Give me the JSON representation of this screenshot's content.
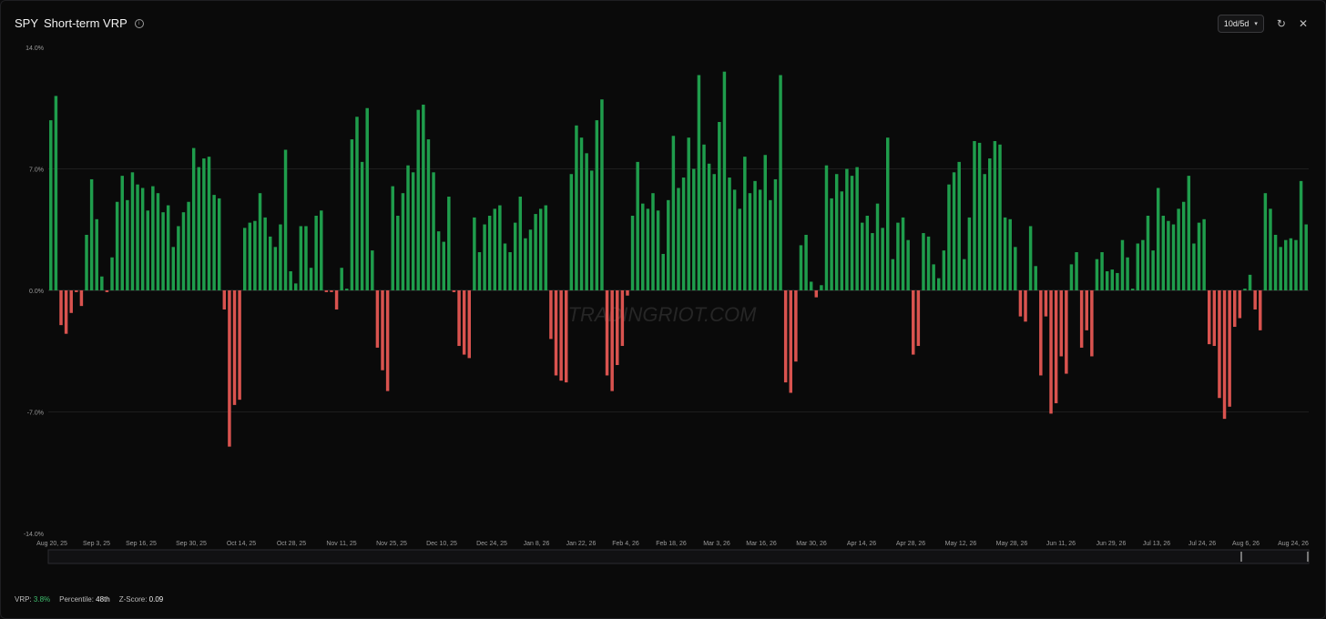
{
  "header": {
    "ticker": "SPY",
    "title": "Short-term VRP",
    "info_icon": "info-icon"
  },
  "controls": {
    "period": "10d/5d",
    "refresh_icon": "refresh-icon",
    "close_icon": "close-icon"
  },
  "watermark": "TRADINGRIOT.COM",
  "footer": {
    "vrp_label": "VRP:",
    "vrp_value": "3.8%",
    "percentile_label": "Percentile:",
    "percentile_value": "48th",
    "zscore_label": "Z-Score:",
    "zscore_value": "0.09"
  },
  "colors": {
    "positive": "#1f9d4c",
    "negative": "#d9534f",
    "grid": "#2a2a2a",
    "text": "#9a9a9a"
  },
  "chart_data": {
    "type": "bar",
    "ylim": [
      -14,
      14
    ],
    "yticks": [
      "14.0%",
      "7.0%",
      "0.0%",
      "-7.0%",
      "-14.0%"
    ],
    "ytick_values": [
      14,
      7,
      0,
      -7,
      -14
    ],
    "xticks": [
      "Aug 20, 25",
      "Sep 3, 25",
      "Sep 16, 25",
      "Sep 30, 25",
      "Oct 14, 25",
      "Oct 28, 25",
      "Nov 11, 25",
      "Nov 25, 25",
      "Dec 10, 25",
      "Dec 24, 25",
      "Jan 8, 26",
      "Jan 22, 26",
      "Feb 4, 26",
      "Feb 18, 26",
      "Mar 3, 26",
      "Mar 16, 26",
      "Mar 30, 26",
      "Apr 14, 26",
      "Apr 28, 26",
      "May 12, 26",
      "May 28, 26",
      "Jun 11, 26",
      "Jun 29, 26",
      "Jul 13, 26",
      "Jul 24, 26",
      "Aug 6, 26",
      "Aug 24, 26"
    ],
    "values": [
      9.8,
      11.2,
      -2.0,
      -2.5,
      -1.3,
      -0.1,
      -0.9,
      3.2,
      6.4,
      4.1,
      0.8,
      -0.1,
      1.9,
      5.1,
      6.6,
      5.2,
      6.8,
      6.1,
      5.9,
      4.6,
      6.0,
      5.6,
      4.5,
      4.9,
      2.5,
      3.7,
      4.5,
      5.1,
      8.2,
      7.1,
      7.6,
      7.7,
      5.5,
      5.3,
      -1.1,
      -9.0,
      -6.6,
      -6.3,
      3.6,
      3.9,
      4.0,
      5.6,
      4.2,
      3.1,
      2.5,
      3.8,
      8.1,
      1.1,
      0.4,
      3.7,
      3.7,
      1.3,
      4.3,
      4.6,
      -0.1,
      -0.1,
      -1.1,
      1.3,
      0.1,
      8.7,
      10.0,
      7.4,
      10.5,
      2.3,
      -3.3,
      -4.6,
      -5.8,
      6.0,
      4.3,
      5.6,
      7.2,
      6.8,
      10.4,
      10.7,
      8.7,
      6.8,
      3.4,
      2.8,
      5.4,
      -0.1,
      -3.2,
      -3.7,
      -3.9,
      4.2,
      2.2,
      3.8,
      4.3,
      4.7,
      4.9,
      2.7,
      2.2,
      3.9,
      5.4,
      3.0,
      3.5,
      4.4,
      4.7,
      4.9,
      -2.8,
      -4.9,
      -5.2,
      -5.3,
      6.7,
      9.5,
      8.8,
      7.9,
      6.9,
      9.8,
      11.0,
      -4.9,
      -5.8,
      -4.3,
      -3.2,
      -0.3,
      4.3,
      7.4,
      5.0,
      4.7,
      5.6,
      4.6,
      2.1,
      5.2,
      8.9,
      5.9,
      6.5,
      8.8,
      7.0,
      12.4,
      8.4,
      7.3,
      6.7,
      9.7,
      12.6,
      6.5,
      5.8,
      4.7,
      7.7,
      5.6,
      6.3,
      5.8,
      7.8,
      5.2,
      6.4,
      12.4,
      -5.3,
      -5.9,
      -4.1,
      2.6,
      3.2,
      0.5,
      -0.4,
      0.3,
      7.2,
      5.3,
      6.7,
      5.7,
      7.0,
      6.6,
      7.1,
      3.9,
      4.3,
      3.3,
      5.0,
      3.6,
      8.8,
      1.8,
      3.9,
      4.2,
      2.9,
      -3.7,
      -3.2,
      3.3,
      3.1,
      1.5,
      0.7,
      2.3,
      6.1,
      6.8,
      7.4,
      1.8,
      4.2,
      8.6,
      8.5,
      6.7,
      7.6,
      8.6,
      8.4,
      4.2,
      4.1,
      2.5,
      -1.5,
      -1.8,
      3.7,
      1.4,
      -4.9,
      -1.5,
      -7.1,
      -6.5,
      -3.8,
      -4.8,
      1.5,
      2.2,
      -3.3,
      -2.3,
      -3.8,
      1.8,
      2.2,
      1.1,
      1.2,
      1.0,
      2.9,
      1.9,
      0.1,
      2.7,
      2.9,
      4.3,
      2.3,
      5.9,
      4.3,
      4.0,
      3.8,
      4.7,
      5.1,
      6.6,
      2.7,
      3.9,
      4.1,
      -3.1,
      -3.2,
      -6.2,
      -7.4,
      -6.7,
      -2.1,
      -1.6,
      0.1,
      0.9,
      -1.1,
      -2.3,
      5.6,
      4.7,
      3.2,
      2.5,
      2.9,
      3.0,
      2.9,
      6.3,
      3.8
    ]
  }
}
